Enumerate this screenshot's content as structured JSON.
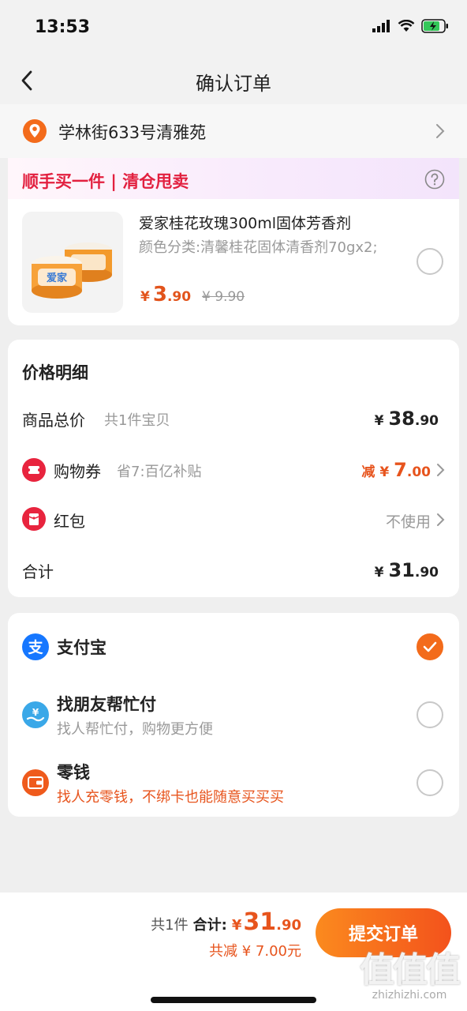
{
  "status": {
    "time": "13:53"
  },
  "nav": {
    "title": "确认订单"
  },
  "address": {
    "text": "学林街633号清雅苑"
  },
  "promo": {
    "title": "顺手买一件 | 清仓甩卖",
    "product": {
      "name": "爱家桂花玫瑰300ml固体芳香剂",
      "spec": "颜色分类:清馨桂花固体清香剂70gx2;",
      "yen": "¥",
      "price_int": "3",
      "price_dec": ".90",
      "original_price": "¥ 9.90",
      "image_brand": "爱家"
    }
  },
  "price_detail": {
    "title": "价格明细",
    "goods_total": {
      "label": "商品总价",
      "sub": "共1件宝贝",
      "yen": "¥",
      "int": "38",
      "dec": ".90"
    },
    "coupon": {
      "label": "购物券",
      "sub": "省7:百亿补贴",
      "prefix": "减",
      "yen": "¥",
      "int": "7",
      "dec": ".00"
    },
    "red_packet": {
      "label": "红包",
      "value": "不使用"
    },
    "sum": {
      "label": "合计",
      "yen": "¥",
      "int": "31",
      "dec": ".90"
    }
  },
  "payment": {
    "options": [
      {
        "name": "支付宝",
        "desc": ""
      },
      {
        "name": "找朋友帮忙付",
        "desc": "找人帮忙付，购物更方便"
      },
      {
        "name": "零钱",
        "desc": "找人充零钱，不绑卡也能随意买买买"
      }
    ]
  },
  "bottom": {
    "count": "共1件",
    "total_label": "合计:",
    "yen": "¥",
    "total_int": "31",
    "total_dec": ".90",
    "saved": "共减 ¥ 7.00元",
    "submit_label": "提交订单"
  },
  "watermark": {
    "logo": "值值值",
    "site": "zhizhizhi.com"
  },
  "colors": {
    "accent": "#f36b1b",
    "price": "#e7541d",
    "promo": "#e2203f",
    "alipay": "#1677ff"
  }
}
